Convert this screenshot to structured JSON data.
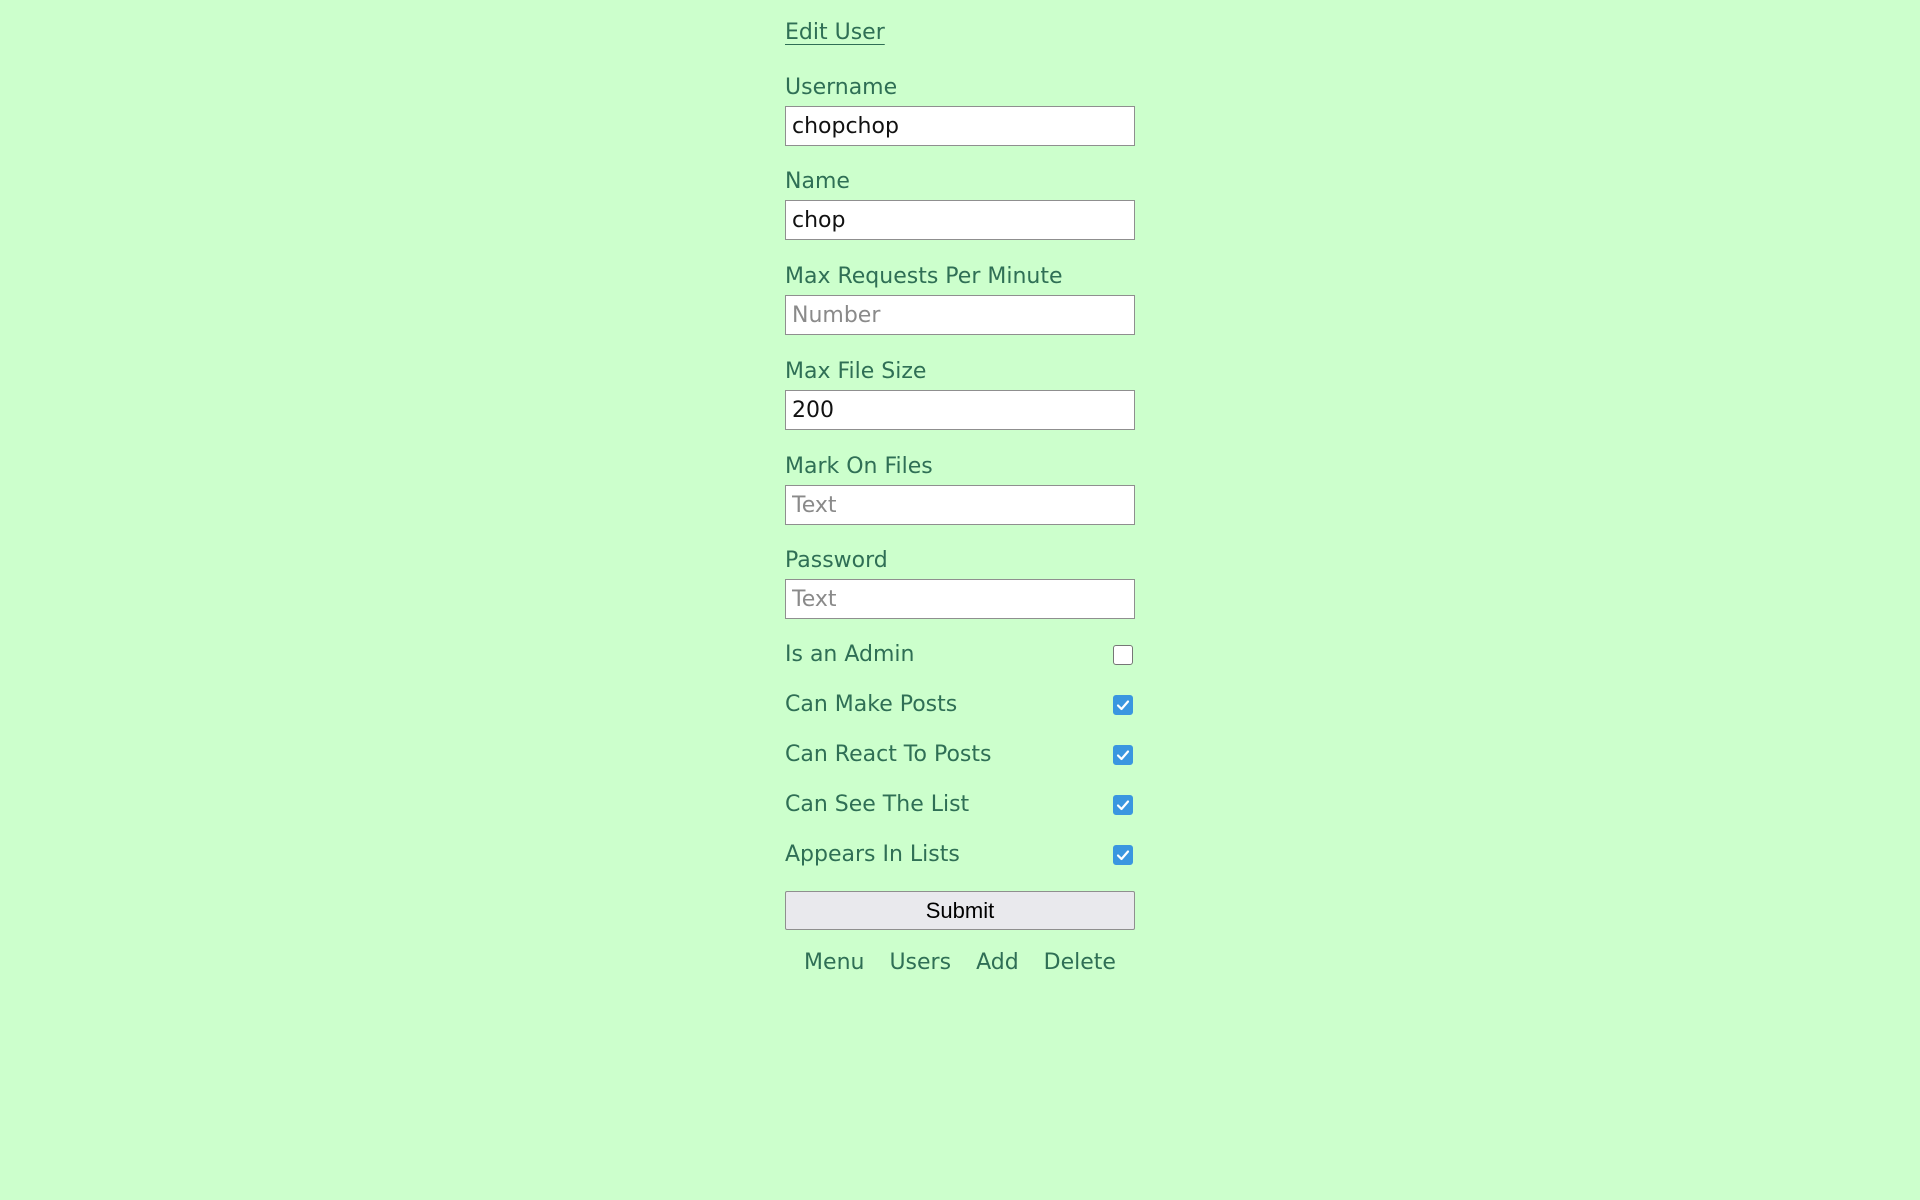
{
  "page": {
    "title": "Edit User"
  },
  "fields": {
    "username": {
      "label": "Username",
      "value": "chopchop",
      "placeholder": ""
    },
    "name": {
      "label": "Name",
      "value": "chop",
      "placeholder": ""
    },
    "max_requests": {
      "label": "Max Requests Per Minute",
      "value": "",
      "placeholder": "Number"
    },
    "max_file_size": {
      "label": "Max File Size",
      "value": "200",
      "placeholder": ""
    },
    "mark_on_files": {
      "label": "Mark On Files",
      "value": "",
      "placeholder": "Text"
    },
    "password": {
      "label": "Password",
      "value": "",
      "placeholder": "Text"
    }
  },
  "checkboxes": {
    "is_admin": {
      "label": "Is an Admin",
      "checked": false
    },
    "can_make_posts": {
      "label": "Can Make Posts",
      "checked": true
    },
    "can_react": {
      "label": "Can React To Posts",
      "checked": true
    },
    "can_see_list": {
      "label": "Can See The List",
      "checked": true
    },
    "appears_in_lists": {
      "label": "Appears In Lists",
      "checked": true
    }
  },
  "actions": {
    "submit_label": "Submit"
  },
  "nav": {
    "menu": "Menu",
    "users": "Users",
    "add": "Add",
    "delete": "Delete"
  },
  "colors": {
    "background": "#ccffcc",
    "text": "#2f6f55",
    "checkbox_accent": "#3a96e0"
  }
}
